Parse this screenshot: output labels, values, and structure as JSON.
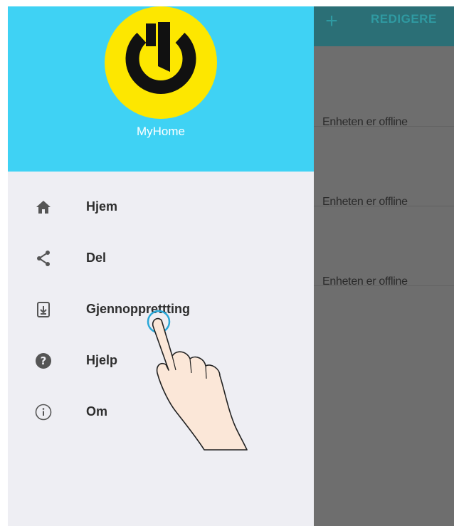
{
  "background_app": {
    "add_icon": "plus-icon",
    "edit_label": "REDIGERE",
    "rows": [
      {
        "status": "Enheten er offline"
      },
      {
        "status": "Enheten er offline"
      },
      {
        "status": "Enheten er offline"
      }
    ]
  },
  "drawer": {
    "header_color": "#3fd2f4",
    "logo_color": "#fde700",
    "app_name": "MyHome",
    "items": [
      {
        "label": "Hjem",
        "icon": "home-icon"
      },
      {
        "label": "Del",
        "icon": "share-icon"
      },
      {
        "label": "Gjennopprettting",
        "icon": "restore-icon"
      },
      {
        "label": "Hjelp",
        "icon": "help-icon"
      },
      {
        "label": "Om",
        "icon": "info-icon"
      }
    ]
  },
  "touch_indicator": {
    "icon": "hand-pointer-icon"
  }
}
